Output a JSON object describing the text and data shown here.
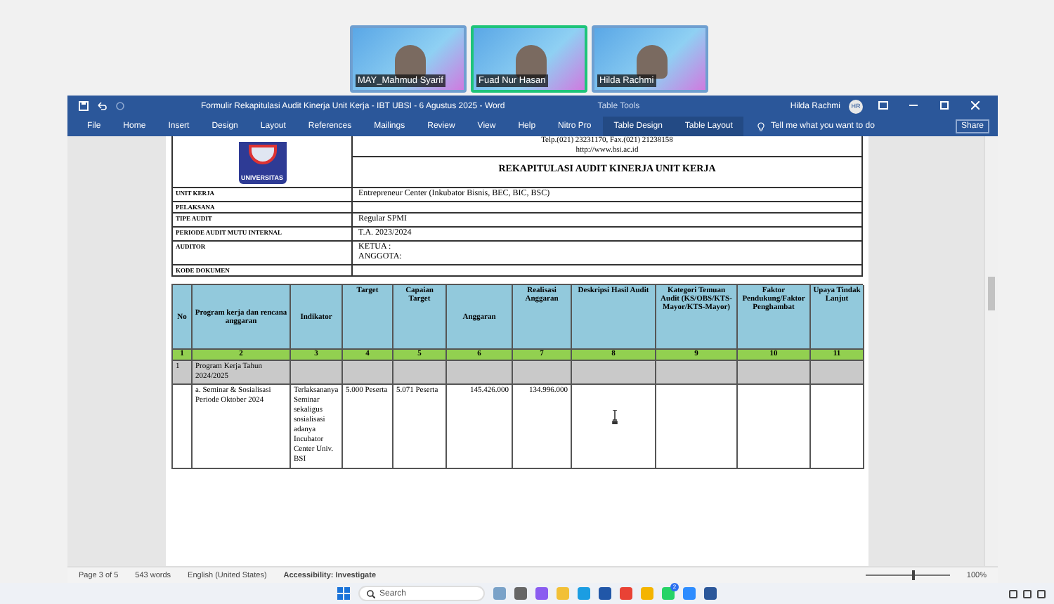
{
  "video_call": {
    "participants": [
      {
        "name": "MAY_Mahmud Syarif",
        "selected": false
      },
      {
        "name": "Fuad Nur Hasan",
        "selected": true
      },
      {
        "name": "Hilda Rachmi",
        "selected": false
      }
    ]
  },
  "window": {
    "title": "Formulir Rekapitulasi Audit Kinerja Unit Kerja - IBT UBSI - 6 Agustus 2025  -  Word",
    "context_label": "Table Tools",
    "user": "Hilda Rachmi",
    "user_initials": "HR"
  },
  "ribbon_tabs": [
    {
      "label": "File",
      "selected": false
    },
    {
      "label": "Home",
      "selected": false
    },
    {
      "label": "Insert",
      "selected": false
    },
    {
      "label": "Design",
      "selected": false
    },
    {
      "label": "Layout",
      "selected": false
    },
    {
      "label": "References",
      "selected": false
    },
    {
      "label": "Mailings",
      "selected": false
    },
    {
      "label": "Review",
      "selected": false
    },
    {
      "label": "View",
      "selected": false
    },
    {
      "label": "Help",
      "selected": false
    },
    {
      "label": "Nitro Pro",
      "selected": false
    },
    {
      "label": "Table Design",
      "selected": false
    },
    {
      "label": "Table Layout",
      "selected": false
    }
  ],
  "tell_me": "Tell me what you want to do",
  "share": "Share",
  "document": {
    "logo_text": "UNIVERSITAS",
    "contact": [
      "Telp.(021) 23231170, Fax.(021) 21238158",
      "http://www.bsi.ac.id"
    ],
    "title": "REKAPITULASI AUDIT KINERJA UNIT KERJA",
    "info_rows": [
      {
        "label": "UNIT KERJA",
        "values": [
          "Entrepreneur Center (Inkubator Bisnis, BEC, BIC, BSC)"
        ]
      },
      {
        "label": "PELAKSANA",
        "values": []
      },
      {
        "label": "TIPE AUDIT",
        "values": [
          "Regular SPMI"
        ]
      },
      {
        "label": "PERIODE AUDIT MUTU INTERNAL",
        "values": [
          "T.A. 2023/2024"
        ]
      },
      {
        "label": "AUDITOR",
        "values": [
          "KETUA      :",
          "ANGGOTA:"
        ]
      },
      {
        "label": "KODE DOKUMEN",
        "values": []
      }
    ],
    "table": {
      "columns": [
        {
          "label": "No",
          "number": "1"
        },
        {
          "label": "Program kerja dan rencana anggaran",
          "number": "2"
        },
        {
          "label": "Indikator",
          "number": "3"
        },
        {
          "label": "Target",
          "number": "4"
        },
        {
          "label": "Capaian Target",
          "number": "5"
        },
        {
          "label": "Anggaran",
          "number": "6"
        },
        {
          "label": "Realisasi Anggaran",
          "number": "7"
        },
        {
          "label": "Deskripsi Hasil Audit",
          "number": "8"
        },
        {
          "label": "Kategori Temuan Audit (KS/OBS/KTS-Mayor/KTS-Mayor)",
          "number": "9"
        },
        {
          "label": "Faktor Pendukung/Faktor Penghambat",
          "number": "10"
        },
        {
          "label": "Upaya Tindak Lanjut",
          "number": "11"
        }
      ],
      "rows": [
        {
          "kind": "group",
          "cells": [
            "1",
            "Program Kerja Tahun 2024/2025"
          ]
        },
        {
          "kind": "item",
          "cells": [
            "",
            "a. Seminar & Sosialisasi Periode Oktober 2024",
            "Terlaksananya Seminar sekaligus sosialisasi adanya Incubator Center Univ. BSI",
            "5.000 Peserta",
            "5.071 Peserta",
            "145.426.000",
            "134.996.000",
            "",
            "",
            "",
            ""
          ]
        }
      ]
    }
  },
  "status_bar": {
    "page": "Page 3 of 5",
    "words": "543 words",
    "language": "English (United States)",
    "accessibility": "Accessibility: Investigate",
    "zoom": "100%",
    "zoom_slider": {
      "level": 0.55
    }
  },
  "taskbar": {
    "search": "Search",
    "badge": "2"
  }
}
